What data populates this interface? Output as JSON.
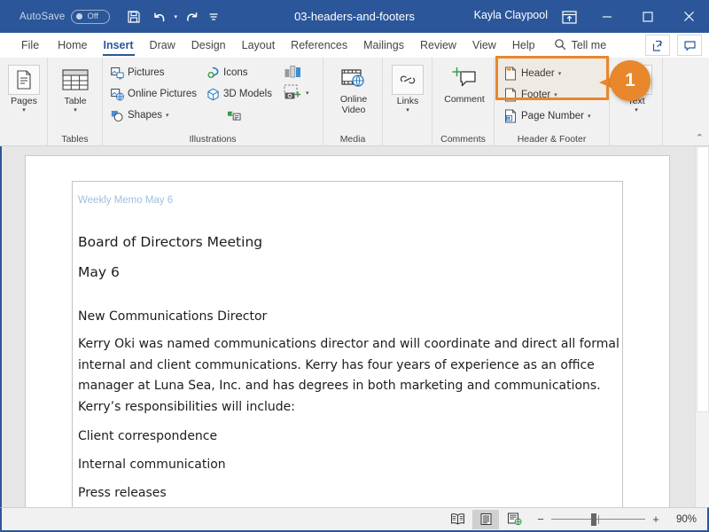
{
  "titlebar": {
    "autosave_label": "AutoSave",
    "autosave_state": "Off",
    "document_title": "03-headers-and-footers",
    "account_name": "Kayla Claypool",
    "quick_access": [
      {
        "name": "save-icon",
        "label": "Save"
      },
      {
        "name": "undo-icon",
        "label": "Undo"
      },
      {
        "name": "redo-icon",
        "label": "Redo"
      },
      {
        "name": "customize-qat-icon",
        "label": "Customize Quick Access Toolbar"
      }
    ],
    "ribbon_display_options": "Ribbon Display Options",
    "minimize": "Minimize",
    "restore": "Restore Down",
    "close": "Close"
  },
  "tabs": [
    {
      "label": "File",
      "active": false
    },
    {
      "label": "Home",
      "active": false
    },
    {
      "label": "Insert",
      "active": true
    },
    {
      "label": "Draw",
      "active": false
    },
    {
      "label": "Design",
      "active": false
    },
    {
      "label": "Layout",
      "active": false
    },
    {
      "label": "References",
      "active": false
    },
    {
      "label": "Mailings",
      "active": false
    },
    {
      "label": "Review",
      "active": false
    },
    {
      "label": "View",
      "active": false
    },
    {
      "label": "Help",
      "active": false
    }
  ],
  "tellme": {
    "label": "Tell me",
    "icon": "search-icon"
  },
  "tab_right_buttons": [
    {
      "name": "share-button",
      "icon": "share-icon"
    },
    {
      "name": "comments-button",
      "icon": "comment-icon"
    }
  ],
  "ribbon": {
    "groups": [
      {
        "name": "pages",
        "label": ""
      },
      {
        "name": "tables",
        "label": "Tables"
      },
      {
        "name": "illustrations",
        "label": "Illustrations"
      },
      {
        "name": "media",
        "label": "Media"
      },
      {
        "name": "links",
        "label": ""
      },
      {
        "name": "comments",
        "label": "Comments"
      },
      {
        "name": "header-footer",
        "label": "Header & Footer"
      },
      {
        "name": "text",
        "label": ""
      }
    ],
    "pages": {
      "label": "Pages",
      "icon": "page-icon"
    },
    "table": {
      "label": "Table",
      "icon": "table-icon"
    },
    "illustrations": {
      "pictures": {
        "label": "Pictures",
        "icon": "pictures-icon"
      },
      "online_pictures": {
        "label": "Online Pictures",
        "icon": "online-pictures-icon"
      },
      "shapes": {
        "label": "Shapes",
        "icon": "shapes-icon"
      },
      "icons": {
        "label": "Icons",
        "icon": "icons-icon"
      },
      "models3d": {
        "label": "3D Models",
        "icon": "3d-model-icon"
      },
      "chart": {
        "label": "Chart",
        "icon": "chart-icon"
      },
      "screenshot": {
        "label": "Screenshot",
        "icon": "screenshot-icon"
      },
      "smartart": {
        "label": "SmartArt",
        "icon": "smartart-icon"
      }
    },
    "online_video": {
      "label": "Online Video",
      "icon": "online-video-icon"
    },
    "links": {
      "label": "Links",
      "icon": "links-icon"
    },
    "comment": {
      "label": "Comment",
      "icon": "new-comment-icon"
    },
    "header": {
      "label": "Header",
      "icon": "header-icon"
    },
    "footer": {
      "label": "Footer",
      "icon": "footer-icon"
    },
    "page_number": {
      "label": "Page Number",
      "icon": "page-number-icon"
    },
    "text": {
      "label": "Text",
      "icon": "text-box-icon"
    },
    "expand": "Ribbon expand"
  },
  "callout": {
    "number": "1",
    "color": "#e8872b"
  },
  "document": {
    "header_text": "Weekly Memo May 6",
    "title": "Board of Directors Meeting",
    "date": "May 6",
    "section_heading": "New Communications Director",
    "paragraph": "Kerry Oki was named communications director and will coordinate and direct all formal internal and client communications. Kerry has four years of experience as an office manager at Luna Sea, Inc. and has degrees in both marketing and communications. Kerry’s responsibilities will include:",
    "list": [
      "Client correspondence",
      "Internal communication",
      "Press releases"
    ]
  },
  "statusbar": {
    "views": [
      {
        "name": "read-mode-button",
        "icon": "read-mode-icon",
        "selected": false
      },
      {
        "name": "print-layout-button",
        "icon": "print-layout-icon",
        "selected": true
      },
      {
        "name": "web-layout-button",
        "icon": "web-layout-icon",
        "selected": false
      }
    ],
    "zoom_out": "−",
    "zoom_in": "+",
    "zoom_level": "90%"
  },
  "colors": {
    "word_blue": "#2b579a",
    "accent_orange": "#e8872b",
    "header_text_blue": "#9fc0e0"
  }
}
